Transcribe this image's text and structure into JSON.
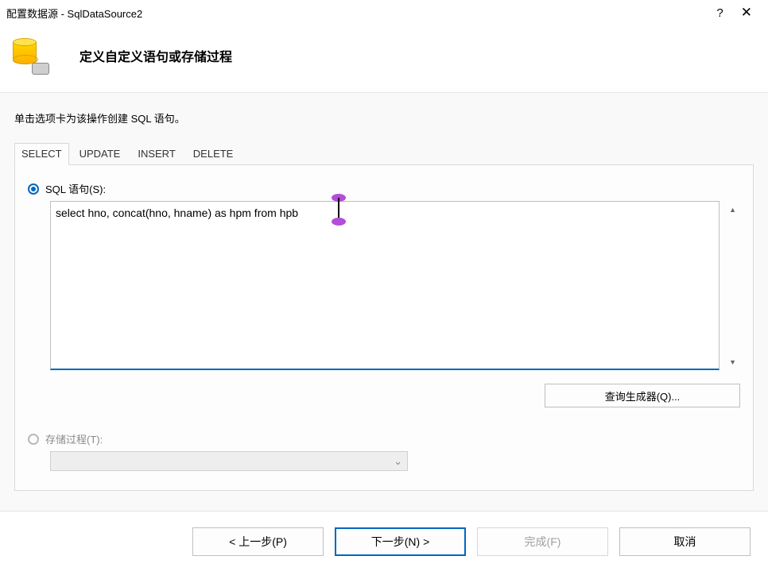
{
  "titlebar": {
    "title": "配置数据源 - SqlDataSource2",
    "close_symbol": "✕",
    "help_symbol": "?"
  },
  "header": {
    "title": "定义自定义语句或存储过程"
  },
  "instruction": "单击选项卡为该操作创建 SQL 语句。",
  "tabs": {
    "select": "SELECT",
    "update": "UPDATE",
    "insert": "INSERT",
    "delete": "DELETE"
  },
  "panel": {
    "sql_radio_label": "SQL 语句(S):",
    "sql_text": "select hno, concat(hno, hname) as hpm from hpb",
    "query_builder_label": "查询生成器(Q)...",
    "sp_radio_label": "存储过程(T):"
  },
  "footer": {
    "prev": "< 上一步(P)",
    "next": "下一步(N) >",
    "finish": "完成(F)",
    "cancel": "取消"
  }
}
